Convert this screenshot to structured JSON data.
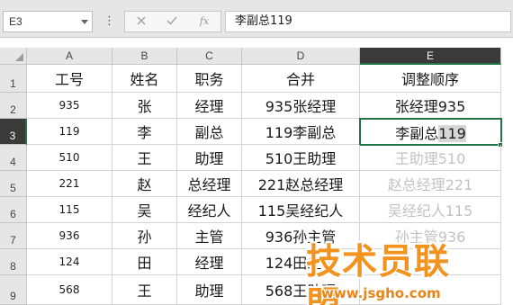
{
  "formula_bar": {
    "name_box": "E3",
    "menu_icon": "vertical-dots-icon",
    "cancel_icon": "close-icon",
    "enter_icon": "check-icon",
    "function_icon": "fx-icon",
    "fx_label": "fx",
    "formula_text": "李副总119"
  },
  "columns": [
    "A",
    "B",
    "C",
    "D",
    "E"
  ],
  "rows": [
    "1",
    "2",
    "3",
    "4",
    "5",
    "6",
    "7",
    "8",
    "9"
  ],
  "sheet": {
    "headers": [
      "工号",
      "姓名",
      "职务",
      "合并",
      "调整顺序"
    ],
    "data": [
      [
        "935",
        "张",
        "经理",
        "935张经理",
        "张经理935"
      ],
      [
        "119",
        "李",
        "副总",
        "119李副总",
        "李副总119"
      ],
      [
        "510",
        "王",
        "助理",
        "510王助理",
        "王助理510"
      ],
      [
        "221",
        "赵",
        "总经理",
        "221赵总经理",
        "赵总经理221"
      ],
      [
        "115",
        "吴",
        "经纪人",
        "115吴经纪人",
        "吴经纪人115"
      ],
      [
        "936",
        "孙",
        "主管",
        "936孙主管",
        "孙主管936"
      ],
      [
        "124",
        "田",
        "经理",
        "124田经理",
        ""
      ],
      [
        "568",
        "王",
        "助理",
        "568王助理",
        ""
      ]
    ]
  },
  "active_cell": {
    "editing_prefix": "李副总",
    "editing_selected": "119"
  },
  "colors": {
    "selection_green": "#217346",
    "ghost_text": "#c2c2c2",
    "header_bg": "#e6e6e6"
  },
  "watermark": {
    "logo_text": "技术员联盟",
    "url_text": "www.jsgho.com"
  }
}
